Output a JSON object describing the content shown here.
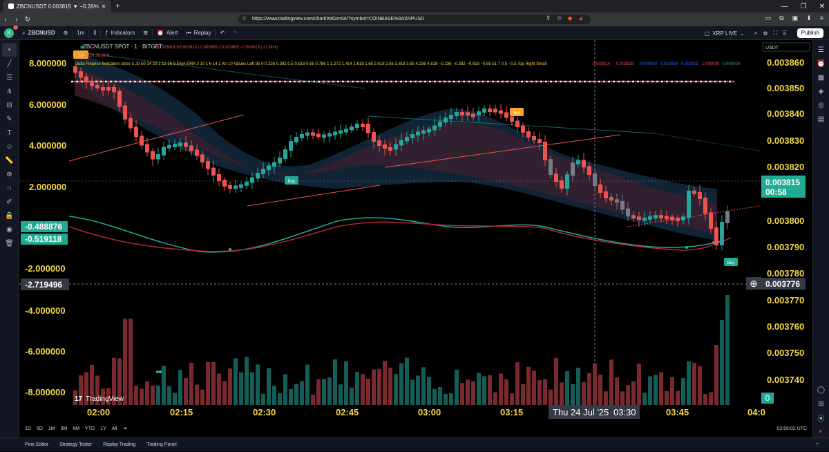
{
  "browser": {
    "tab_title": "ZBCNUSDT 0.003815 ▼ −0.26%",
    "new_tab": "+",
    "url": "https://www.tradingview.com/chart/AttGsmlA/?symbol=COINBASE%3AXRPUSD",
    "controls": [
      "—",
      "❐",
      "✕"
    ]
  },
  "toolbar": {
    "avatar_letter": "K",
    "avatar_badge": "11",
    "symbol": "ZBCNUSD",
    "interval": "1m",
    "indicators": "Indicators",
    "alert": "Alert",
    "replay": "Replay",
    "live": "XRP LIVE",
    "publish": "Publish"
  },
  "legend": {
    "title": "ZBCNUSDT SPOT · 1 · BITGET",
    "ohlc": "O0.003818 H0.003819 L0.003805 C0.003805 −0.000013 (−0.34%)",
    "volume": "Vol ZBCN 38.96 K",
    "indicator": "Jubs Finance Indicators close 5 20 50 14 20 1 12 26 9 EMA EMA 3 10 1 6 14 1 Atr 10 Values Left 85 0 0.236 0.382 0.5 0.618 0.65 0.786 1 1.272 1.414 1.618 1.65 2.618 2.65 3.618 3.65 4.236 4.618 −0.236 −0.382 −0.618 −0.65 51 7 0.5 −0.5 Top Right Small",
    "indicator_values": [
      "0.003814",
      "0.003828",
      "0.000000",
      "0.003836",
      "0.003815",
      "1.000000",
      "0.000000"
    ],
    "currency": "USDT"
  },
  "price_axis": {
    "ticks": [
      "0.003860",
      "0.003850",
      "0.003840",
      "0.003830",
      "0.003820",
      "0.003800",
      "0.003790",
      "0.003780",
      "0.003770",
      "0.003760",
      "0.003750",
      "0.003740"
    ],
    "current_price": "0.003815",
    "countdown": "00:58",
    "cursor_price": "0.003776",
    "volume_label": "0"
  },
  "osc_axis": {
    "ticks": [
      "8.000000",
      "6.000000",
      "4.000000",
      "2.000000",
      "-2.000000",
      "-4.000000",
      "-6.000000",
      "-8.000000"
    ],
    "label_green_1": "-0.488876",
    "label_green_2": "-0.519118",
    "cursor_value": "-2.719496"
  },
  "time_axis": {
    "ticks": [
      "02:00",
      "02:15",
      "02:30",
      "02:45",
      "03:00",
      "03:15",
      "03:45",
      "04:0"
    ],
    "cursor_label": "Thu 24 Jul '25",
    "cursor_time": "03:30"
  },
  "signals": {
    "buy": "Buy",
    "sell": "Sell"
  },
  "watermark": "TradingView",
  "range_buttons": [
    "1D",
    "5D",
    "1M",
    "3M",
    "6M",
    "YTD",
    "1Y",
    "All"
  ],
  "clock": "03:55:02 UTC",
  "bottom_tabs": [
    "Pine Editor",
    "Strategy Tester",
    "Replay Trading",
    "Trading Panel"
  ],
  "colors": {
    "up": "#26a69a",
    "down": "#ef5350",
    "neutral": "#787b86",
    "current_price_bg": "#22ab94",
    "axis_yellow": "#f5d742"
  }
}
